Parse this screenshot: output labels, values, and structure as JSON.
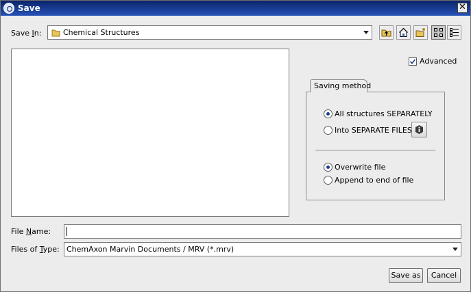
{
  "window": {
    "title": "Save",
    "close_glyph": "✕"
  },
  "save_in": {
    "label_pre": "Save ",
    "label_mnemonic": "I",
    "label_post": "n:",
    "folder_icon": "folder-icon",
    "selected": "Chemical Structures"
  },
  "toolbar": {
    "icons": [
      "up-folder-icon",
      "home-icon",
      "new-folder-icon",
      "list-view-icon",
      "details-view-icon"
    ]
  },
  "advanced": {
    "label": "Advanced",
    "checked": true
  },
  "saving_method": {
    "tab_label": "Saving method",
    "structures": [
      {
        "label": "All structures SEPARATELY",
        "selected": true
      },
      {
        "label": "Into SEPARATE FILES",
        "selected": false
      }
    ],
    "file_modes": [
      {
        "label": "Overwrite file",
        "selected": true
      },
      {
        "label": "Append to end of file",
        "selected": false
      }
    ]
  },
  "file_name": {
    "label_pre": "File ",
    "label_mnemonic": "N",
    "label_post": "ame:",
    "value": ""
  },
  "files_of_type": {
    "label_pre": "Files of ",
    "label_mnemonic": "T",
    "label_post": "ype:",
    "selected": "ChemAxon Marvin Documents / MRV (*.mrv)"
  },
  "buttons": {
    "save_as": "Save as",
    "cancel": "Cancel"
  }
}
